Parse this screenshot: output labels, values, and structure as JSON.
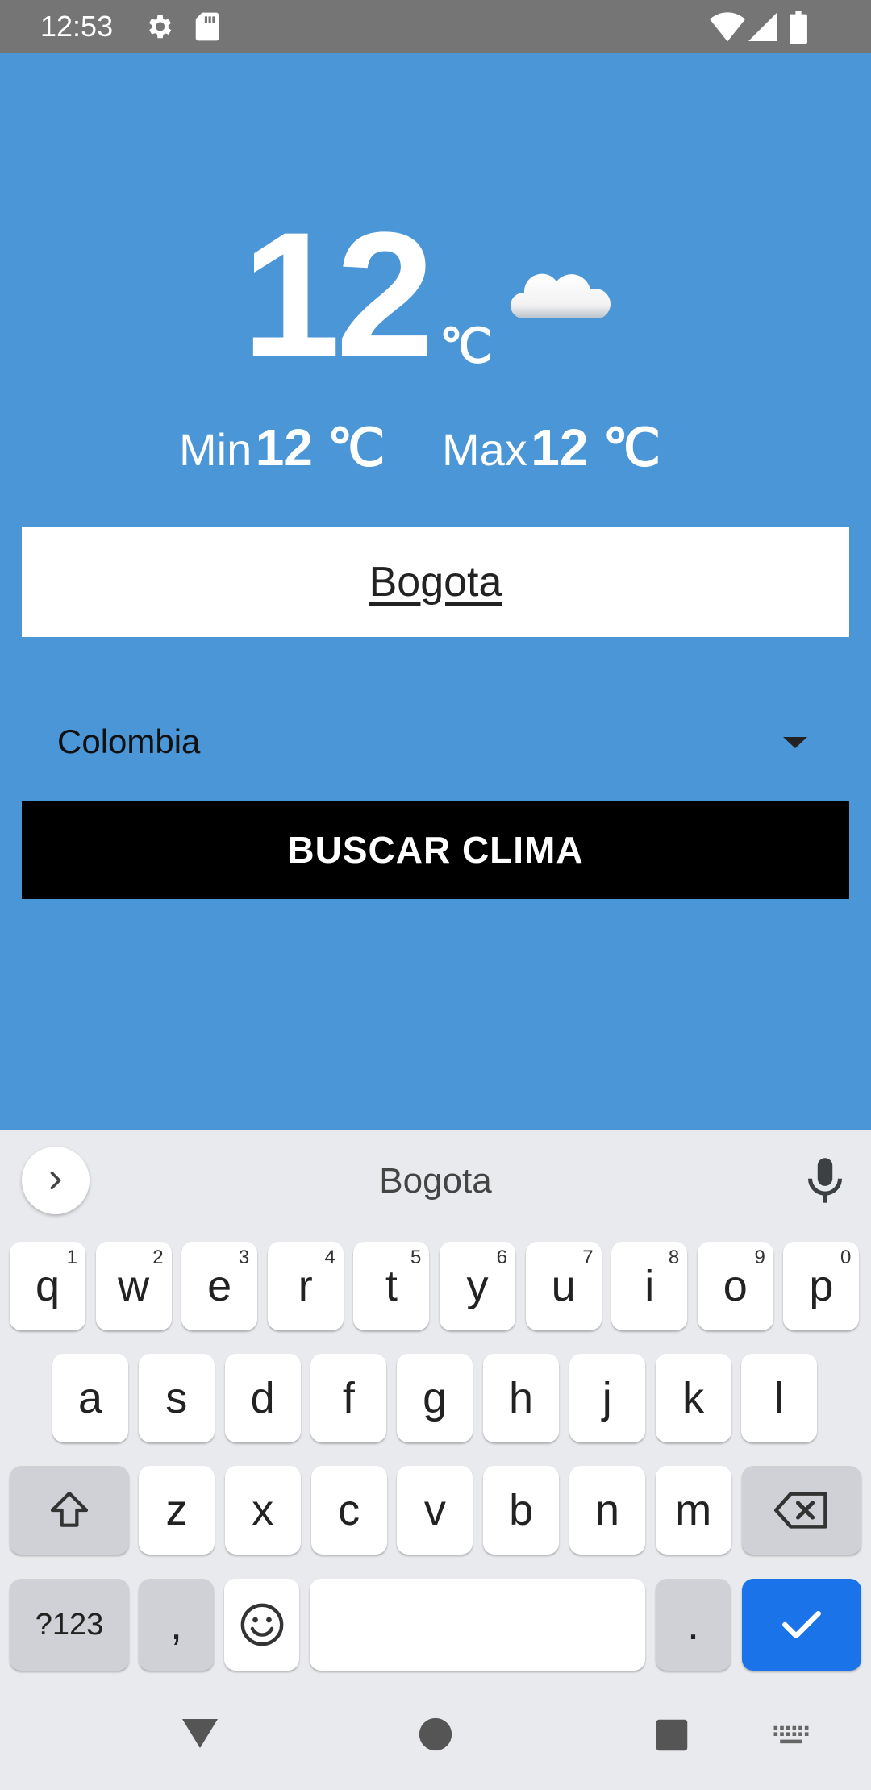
{
  "status_bar": {
    "time": "12:53"
  },
  "weather": {
    "temperature": "12",
    "unit": "℃",
    "condition_icon": "cloud-icon",
    "min_label": "Min",
    "min_value": "12 ℃",
    "max_label": "Max",
    "max_value": "12 ℃"
  },
  "form": {
    "city_value": "Bogota",
    "country_selected": "Colombia",
    "search_button": "BUSCAR CLIMA"
  },
  "keyboard": {
    "suggestion": "Bogota",
    "row1": [
      {
        "key": "q",
        "hint": "1"
      },
      {
        "key": "w",
        "hint": "2"
      },
      {
        "key": "e",
        "hint": "3"
      },
      {
        "key": "r",
        "hint": "4"
      },
      {
        "key": "t",
        "hint": "5"
      },
      {
        "key": "y",
        "hint": "6"
      },
      {
        "key": "u",
        "hint": "7"
      },
      {
        "key": "i",
        "hint": "8"
      },
      {
        "key": "o",
        "hint": "9"
      },
      {
        "key": "p",
        "hint": "0"
      }
    ],
    "row2": [
      "a",
      "s",
      "d",
      "f",
      "g",
      "h",
      "j",
      "k",
      "l"
    ],
    "row3": [
      "z",
      "x",
      "c",
      "v",
      "b",
      "n",
      "m"
    ],
    "symbols_key": "?123",
    "comma_key": ",",
    "period_key": "."
  },
  "colors": {
    "background": "#4a96d7",
    "status_bar": "#757575",
    "button": "#000000",
    "enter_key": "#1a73e8"
  }
}
